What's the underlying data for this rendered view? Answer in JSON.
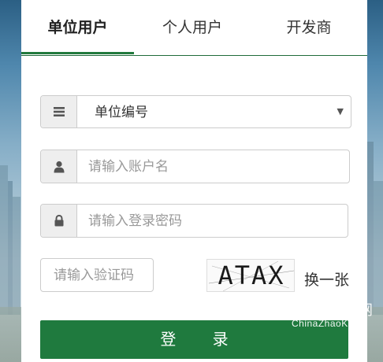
{
  "tabs": [
    {
      "label": "单位用户",
      "active": true
    },
    {
      "label": "个人用户",
      "active": false
    },
    {
      "label": "开发商",
      "active": false
    }
  ],
  "form": {
    "unit_select": {
      "icon": "list-icon",
      "value": "单位编号"
    },
    "username": {
      "icon": "user-icon",
      "placeholder": "请输入账户名"
    },
    "password": {
      "icon": "lock-icon",
      "placeholder": "请输入登录密码"
    },
    "captcha_input": {
      "placeholder": "请输入验证码"
    },
    "captcha_image_text": "ATAX",
    "refresh_label": "换一张",
    "login_label": "登 录"
  },
  "watermark": {
    "text": "ChinaZhaoK",
    "glyph": "网"
  },
  "colors": {
    "accent": "#1f7a3e",
    "tab_underline": "#237a3e",
    "addon_bg": "#eeeeee"
  }
}
